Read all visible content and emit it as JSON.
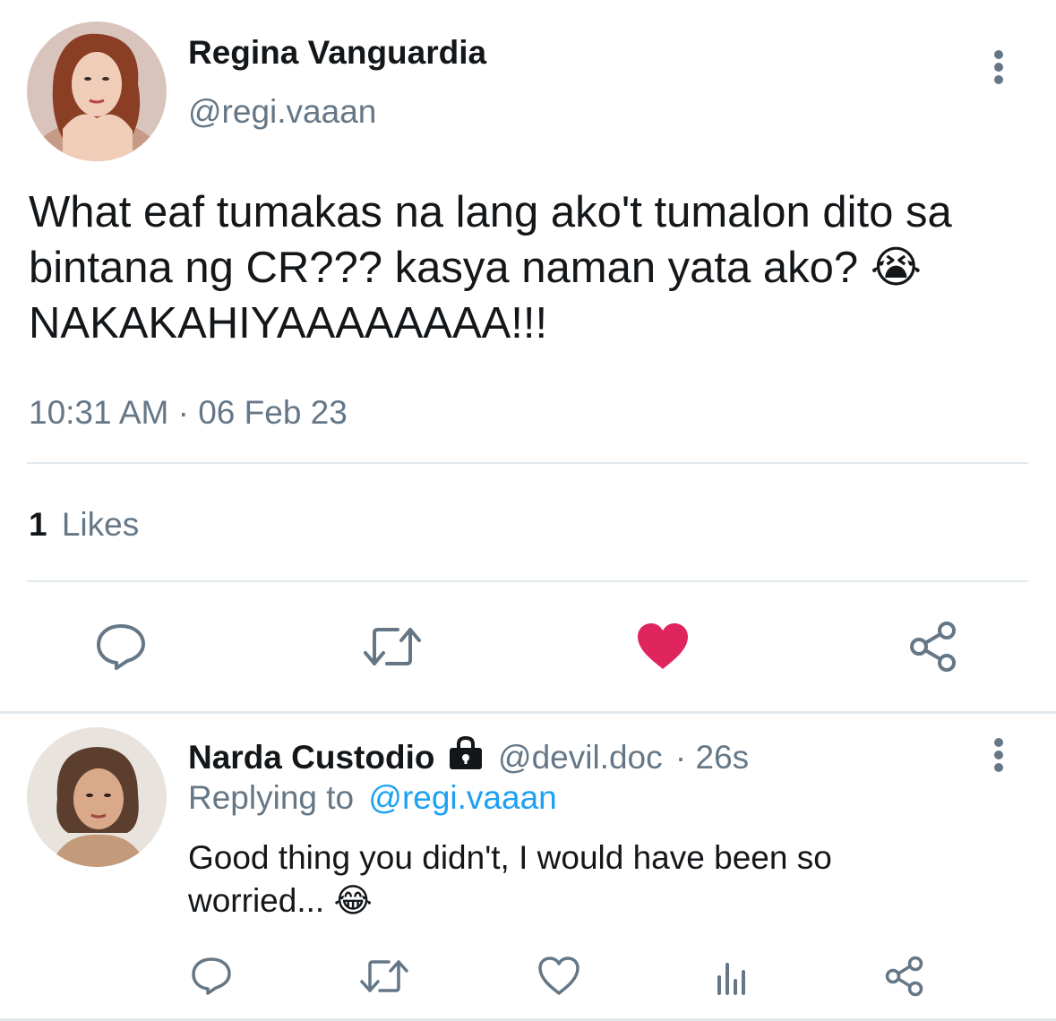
{
  "main_tweet": {
    "author_name": "Regina Vanguardia",
    "author_handle": "@regi.vaaan",
    "text_line1": "What eaf tumakas na lang ako't tumalon dito sa",
    "text_line2": "bintana ng CR??? kasya naman yata ako?",
    "emoji": "😭",
    "text_line3": "NAKAKAHIYAAAAAAAA!!!",
    "timestamp": "10:31 AM · 06 Feb 23",
    "likes_count": "1",
    "likes_label": "Likes",
    "liked": true,
    "like_color": "#e0245e"
  },
  "reply": {
    "author_name": "Narda Custodio",
    "locked_icon": "lock-icon",
    "author_handle": "@devil.doc",
    "time": "· 26s",
    "replying_prefix": "Replying to",
    "replying_handle": "@regi.vaaan",
    "text_line1": "Good thing you didn't, I would have been so",
    "text_line2": "worried...",
    "emoji": "😂"
  },
  "colors": {
    "text_primary": "#14171a",
    "text_secondary": "#657786",
    "link": "#1da1f2",
    "divider": "#e1e8ed",
    "icon": "#657786"
  }
}
